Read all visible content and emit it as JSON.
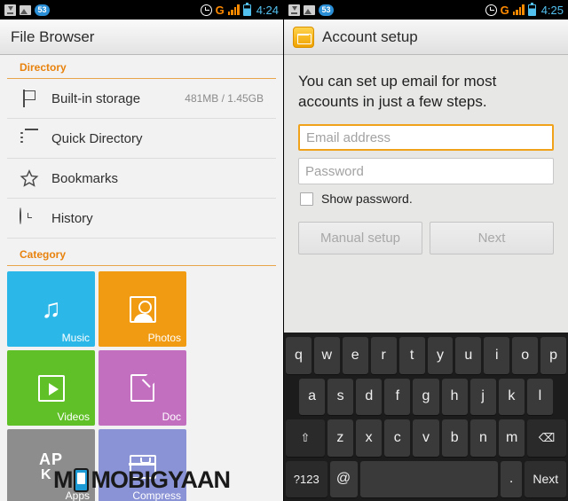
{
  "left": {
    "statusbar": {
      "badge_count": "53",
      "time": "4:24",
      "carrier": "G",
      "icons": [
        "download-icon",
        "photo-icon",
        "badge-53",
        "alarm-clock-icon",
        "signal-bars-icon",
        "battery-icon"
      ]
    },
    "appbar": {
      "title": "File Browser"
    },
    "sections": {
      "directory_header": "Directory",
      "category_header": "Category"
    },
    "rows": [
      {
        "label": "Built-in storage",
        "meta": "481MB / 1.45GB",
        "icon": "storage-flag-icon"
      },
      {
        "label": "Quick Directory",
        "meta": "",
        "icon": "list-icon"
      },
      {
        "label": "Bookmarks",
        "meta": "",
        "icon": "star-icon"
      },
      {
        "label": "History",
        "meta": "",
        "icon": "history-clock-icon"
      }
    ],
    "tiles": [
      {
        "label": "Music",
        "icon": "music-note-icon"
      },
      {
        "label": "Photos",
        "icon": "photo-portrait-icon"
      },
      {
        "label": "Videos",
        "icon": "video-play-icon"
      },
      {
        "label": "Doc",
        "icon": "document-icon"
      },
      {
        "label": "Apps",
        "icon": "apk-icon",
        "glyph_main": "AP",
        "glyph_sub": "K"
      },
      {
        "label": "Compress",
        "icon": "archive-box-icon"
      }
    ],
    "watermark": {
      "text": "MOBIGYAAN"
    }
  },
  "right": {
    "statusbar": {
      "badge_count": "53",
      "time": "4:25",
      "carrier": "G"
    },
    "appbar": {
      "title": "Account setup",
      "icon": "email-app-icon"
    },
    "setup": {
      "title": "You can set up email for most accounts in just a few steps.",
      "email_placeholder": "Email address",
      "password_placeholder": "Password",
      "show_password_label": "Show password.",
      "manual_setup_label": "Manual setup",
      "next_label": "Next"
    },
    "keyboard": {
      "row1": [
        "q",
        "w",
        "e",
        "r",
        "t",
        "y",
        "u",
        "i",
        "o",
        "p"
      ],
      "row2": [
        "a",
        "s",
        "d",
        "f",
        "g",
        "h",
        "j",
        "k",
        "l"
      ],
      "row3_shift": "⇧",
      "row3": [
        "z",
        "x",
        "c",
        "v",
        "b",
        "n",
        "m"
      ],
      "row3_backspace": "⌫",
      "row4_symbols": "?123",
      "row4_at": "@",
      "row4_space": "",
      "row4_period": ".",
      "row4_period_sub": "",
      "row4_enter": "Next"
    }
  }
}
